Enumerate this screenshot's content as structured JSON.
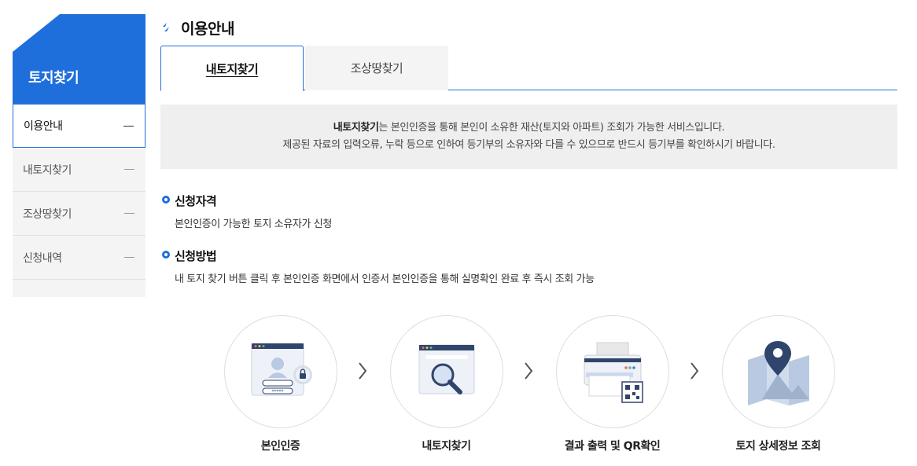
{
  "sidebar": {
    "title": "토지찾기",
    "items": [
      {
        "label": "이용안내"
      },
      {
        "label": "내토지찾기"
      },
      {
        "label": "조상땅찾기"
      },
      {
        "label": "신청내역"
      }
    ]
  },
  "page": {
    "title": "이용안내"
  },
  "tabs": [
    {
      "label": "내토지찾기"
    },
    {
      "label": "조상땅찾기"
    }
  ],
  "info": {
    "line1_bold": "내토지찾기",
    "line1_rest": "는 본인인증을 통해 본인이 소유한 재산(토지와 아파트) 조회가 가능한 서비스입니다.",
    "line2": "제공된 자료의 입력오류, 누락 등으로 인하여 등기부의 소유자와 다를 수 있으므로 반드시 등기부를 확인하시기 바랍니다."
  },
  "sections": [
    {
      "heading": "신청자격",
      "text": "본인인증이 가능한 토지 소유자가 신청"
    },
    {
      "heading": "신청방법",
      "text": "내 토지 찾기 버튼 클릭 후 본인인증 화면에서 인증서 본인인증을 통해 실명확인 완료 후 즉시 조회 가능"
    }
  ],
  "steps": [
    {
      "label": "본인인증",
      "password_mask": "*****"
    },
    {
      "label": "내토지찾기"
    },
    {
      "label": "결과 출력 및 QR확인"
    },
    {
      "label": "토지 상세정보 조회"
    }
  ],
  "colors": {
    "accent": "#1e6fdc",
    "panel": "#efefef",
    "sidebar_bg": "#f4f4f4"
  }
}
